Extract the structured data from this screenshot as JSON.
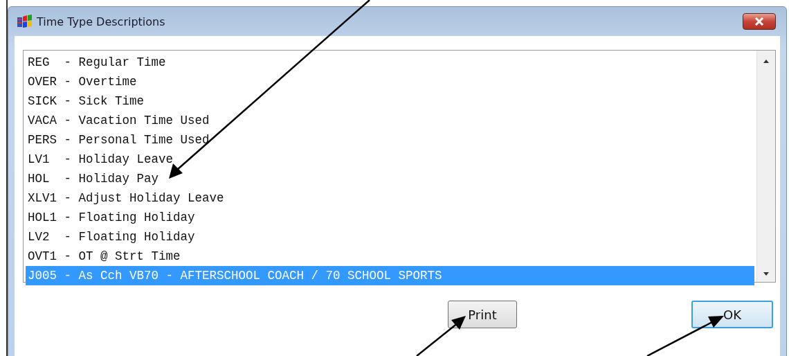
{
  "window": {
    "title": "Time Type Descriptions"
  },
  "list": {
    "items": [
      {
        "text": "REG  - Regular Time",
        "selected": false
      },
      {
        "text": "OVER - Overtime",
        "selected": false
      },
      {
        "text": "SICK - Sick Time",
        "selected": false
      },
      {
        "text": "VACA - Vacation Time Used",
        "selected": false
      },
      {
        "text": "PERS - Personal Time Used",
        "selected": false
      },
      {
        "text": "LV1  - Holiday Leave",
        "selected": false
      },
      {
        "text": "HOL  - Holiday Pay",
        "selected": false
      },
      {
        "text": "XLV1 - Adjust Holiday Leave",
        "selected": false
      },
      {
        "text": "HOL1 - Floating Holiday",
        "selected": false
      },
      {
        "text": "LV2  - Floating Holiday",
        "selected": false
      },
      {
        "text": "OVT1 - OT @ Strt Time",
        "selected": false
      },
      {
        "text": "J005 - As Cch VB70 - AFTERSCHOOL COACH / 70 SCHOOL SPORTS",
        "selected": true
      }
    ]
  },
  "buttons": [
    {
      "label": "Print",
      "kind": "normal"
    },
    {
      "label": "OK",
      "kind": "default"
    }
  ]
}
